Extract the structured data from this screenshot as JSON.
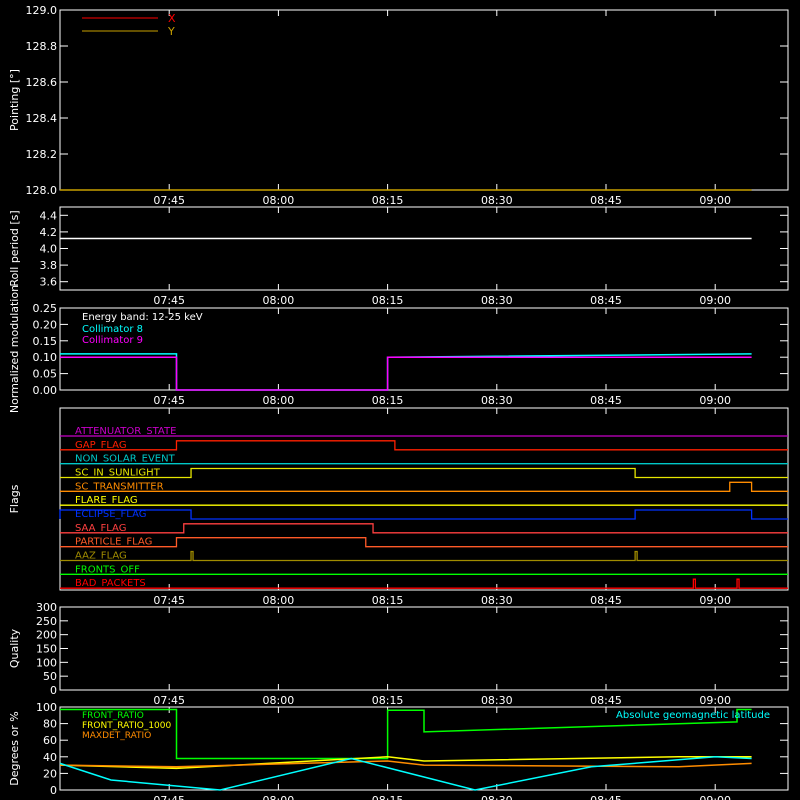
{
  "time_ticks": [
    "07:45",
    "08:00",
    "08:15",
    "08:30",
    "08:45",
    "09:00"
  ],
  "chart_data": [
    {
      "id": "pointing",
      "type": "line",
      "ylabel": "Pointing [°]",
      "ylim": [
        128.0,
        129.0
      ],
      "yticks": [
        "128.0",
        "128.2",
        "128.4",
        "128.6",
        "128.8",
        "129.0"
      ],
      "legend": "top-left",
      "series": [
        {
          "name": "X",
          "color": "#ff0000",
          "values": []
        },
        {
          "name": "Y",
          "color": "#c8a000",
          "x": [
            "07:30",
            "09:05"
          ],
          "values": [
            128.0,
            128.0
          ]
        }
      ]
    },
    {
      "id": "roll",
      "type": "line",
      "ylabel": "Roll period [s]",
      "ylim": [
        3.5,
        4.5
      ],
      "yticks": [
        "3.6",
        "3.8",
        "4.0",
        "4.2",
        "4.4"
      ],
      "series": [
        {
          "name": "",
          "color": "#ffffff",
          "x": [
            "07:30",
            "09:05"
          ],
          "values": [
            4.12,
            4.12
          ]
        }
      ]
    },
    {
      "id": "modulation",
      "type": "line",
      "ylabel": "Normalized modulation",
      "ylim": [
        0,
        0.25
      ],
      "yticks": [
        "0.00",
        "0.05",
        "0.10",
        "0.15",
        "0.20",
        "0.25"
      ],
      "annotation": "Energy band: 12-25 keV",
      "legend": "top-left",
      "series": [
        {
          "name": "Collimator 8",
          "color": "#00ffff",
          "x": [
            "07:30",
            "07:46",
            "07:46",
            "08:15",
            "08:15",
            "09:05"
          ],
          "values": [
            0.11,
            0.11,
            0.0,
            0.0,
            0.1,
            0.11
          ]
        },
        {
          "name": "Collimator 9",
          "color": "#ff00ff",
          "x": [
            "07:30",
            "07:46",
            "07:46",
            "08:15",
            "08:15",
            "09:05"
          ],
          "values": [
            0.1,
            0.1,
            0.0,
            0.0,
            0.1,
            0.1
          ]
        }
      ]
    },
    {
      "id": "flags",
      "type": "line",
      "ylabel": "Flags",
      "flags": [
        {
          "name": "ATTENUATOR_STATE",
          "color": "#c800c8",
          "on": []
        },
        {
          "name": "GAP_FLAG",
          "color": "#ff2000",
          "on": [
            [
              "07:46",
              "08:16"
            ]
          ]
        },
        {
          "name": "NON_SOLAR_EVENT",
          "color": "#00c8c8",
          "on": []
        },
        {
          "name": "SC_IN_SUNLIGHT",
          "color": "#e6e600",
          "on": [
            [
              "07:48",
              "08:49"
            ]
          ]
        },
        {
          "name": "SC_TRANSMITTER",
          "color": "#ff8c00",
          "on": [
            [
              "09:02",
              "09:05"
            ]
          ]
        },
        {
          "name": "FLARE_FLAG",
          "color": "#ffff00",
          "on": []
        },
        {
          "name": "ECLIPSE_FLAG",
          "color": "#0032ff",
          "on": [
            [
              "07:30",
              "07:48"
            ],
            [
              "08:49",
              "09:05"
            ]
          ]
        },
        {
          "name": "SAA_FLAG",
          "color": "#ff4040",
          "on": [
            [
              "07:47",
              "08:13"
            ]
          ]
        },
        {
          "name": "PARTICLE_FLAG",
          "color": "#ff5a28",
          "on": [
            [
              "07:46",
              "08:12"
            ]
          ]
        },
        {
          "name": "AAZ_FLAG",
          "color": "#a08c00",
          "on": [
            [
              "07:48",
              "07:48"
            ],
            [
              "08:49",
              "08:49"
            ]
          ]
        },
        {
          "name": "FRONTS_OFF",
          "color": "#00ff00",
          "on": []
        },
        {
          "name": "BAD_PACKETS",
          "color": "#ff0000",
          "on": [
            [
              "08:57",
              "08:57"
            ],
            [
              "09:03",
              "09:03"
            ]
          ]
        }
      ]
    },
    {
      "id": "quality",
      "type": "line",
      "ylabel": "Quality",
      "ylim": [
        0,
        300
      ],
      "yticks": [
        "0",
        "50",
        "100",
        "150",
        "200",
        "250",
        "300"
      ],
      "series": []
    },
    {
      "id": "ratios",
      "type": "line",
      "ylabel": "Degrees or %",
      "ylim": [
        0,
        100
      ],
      "yticks": [
        "0",
        "20",
        "40",
        "60",
        "80",
        "100"
      ],
      "legend": "top-left",
      "annotation": "Absolute geomagnetic latitude",
      "series": [
        {
          "name": "FRONT_RATIO",
          "color": "#00ff00",
          "x": [
            "07:30",
            "07:46",
            "07:46",
            "08:15",
            "08:15",
            "08:20",
            "08:20",
            "09:03",
            "09:03",
            "09:05"
          ],
          "values": [
            97,
            97,
            38,
            38,
            96,
            96,
            70,
            82,
            97,
            97
          ]
        },
        {
          "name": "FRONT_RATIO_1000",
          "color": "#ffff00",
          "x": [
            "07:30",
            "07:46",
            "08:15",
            "08:20",
            "08:55",
            "09:05"
          ],
          "values": [
            30,
            26,
            40,
            35,
            40,
            40
          ]
        },
        {
          "name": "MAXDET_RATIO",
          "color": "#ff8c00",
          "x": [
            "07:30",
            "07:46",
            "08:15",
            "08:20",
            "08:55",
            "09:05"
          ],
          "values": [
            30,
            28,
            35,
            30,
            28,
            32
          ]
        },
        {
          "name": "Absolute geomagnetic latitude",
          "color": "#00ffff",
          "x": [
            "07:30",
            "07:37",
            "07:52",
            "08:10",
            "08:27",
            "08:43",
            "09:00",
            "09:05"
          ],
          "values": [
            32,
            12,
            0,
            38,
            0,
            28,
            40,
            38
          ]
        }
      ]
    }
  ]
}
